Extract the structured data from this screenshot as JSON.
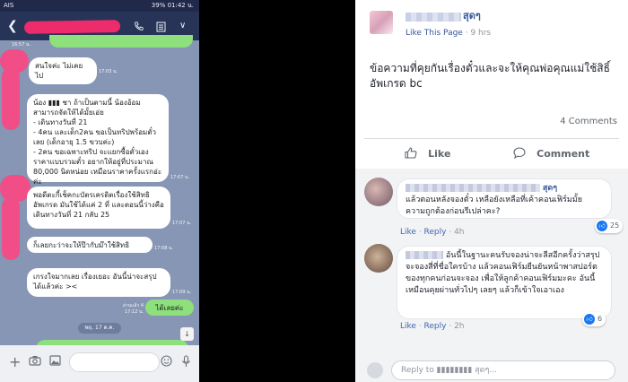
{
  "phone": {
    "status_left": "AIS",
    "status_right": "39% 01:42 น.",
    "header_icons": [
      "back-icon",
      "phone-icon",
      "notes-icon",
      "chevron-down-icon"
    ],
    "messages": [
      {
        "id": "m0",
        "text": "",
        "time": "16:57 น.",
        "side": "left"
      },
      {
        "id": "m1",
        "text": "สนใจค่ะ ไม่เคยไป",
        "time": "17:03 น.",
        "side": "left"
      },
      {
        "id": "m2",
        "text": "น้อง ▮▮▮ ชา ถ้าเป็นตามนี้ น้องอ้อม สามารถจัดให้ได้มั้ยเอ่ย\n- เดินทางวันที่ 21\n- 4คน และเด็ก2คน ขอเป็นทริปพร้อมตั๋วเลย (เด็กอายุ 1.5 ขวบค่ะ)\n- 2คน ขอเฉพาะทริป จะแยกซื้อตั๋วเอง ราคาแบบรวมตั๋ว อยากให้อยู่ที่ประมาณ 80,000 นิดหน่อย เหมือนราคาครั้งแรกอ่ะค่ะ",
        "time": "17:07 น.",
        "side": "left"
      },
      {
        "id": "m3",
        "text": "พอดีตะกี้เช็คกะบัตรเครดิตเรื่องใช้สิทธิอัพเกรด มันใช้ได้แค่ 2 ที่ และตอนนี้ว่างคือเดินทางวันที่ 21 กลับ 25",
        "time": "17:07 น.",
        "side": "left"
      },
      {
        "id": "m4",
        "text": "ก็เลยกะว่าจะให้ป๊ากับม๊าใช้สิทธิ",
        "time": "17:08 น.",
        "side": "left"
      },
      {
        "id": "m5",
        "text": "เกรงใจมากเลย เรื่องเยอะ อันนี้น่าจะสรุปได้แล้วค่ะ >< ",
        "time": "17:09 น.",
        "side": "left"
      },
      {
        "id": "m6",
        "text": "ได้เลยค่ะ",
        "time": "17:12 น.",
        "read": "อ่านแล้ว 4",
        "side": "right"
      }
    ],
    "date_divider": "พฤ. 17 ต.ค.",
    "input_bar_icons": [
      "plus-icon",
      "camera-icon",
      "image-icon",
      "emoji-icon",
      "microphone-icon"
    ]
  },
  "fb": {
    "page_name_suffix": "สุดๆ",
    "like_page": "Like This Page",
    "separator": " · ",
    "post_age": "9 hrs",
    "post_text": "ข้อความที่คุยกันเรื่องตั๋วและจะให้คุณพ่อคุณแม่ใช้สิธิ์อัพเกรด bc",
    "comment_count": "4 Comments",
    "actions": {
      "like": "Like",
      "comment": "Comment"
    },
    "comments": [
      {
        "name_suffix": "สุดๆ",
        "text": "แล้วตอนหลังจองตั๋ว เหลือยังเหลือที่เค้าคอนเฟิร์มมั้ย ความถูกต้องก่อนรีเปล่าคะ?",
        "like": "Like",
        "reply": "Reply",
        "age": "4h",
        "reactions": "25"
      },
      {
        "name_suffix": "",
        "text": "อันนี้ในฐานะคนรับจองน่าจะลีสอีกครั้งว่าสรุปจะจองสี่ที่ชื่อใครบ้าง แล้วคอนเฟิร์มยืนยันหน้าพาสปอร์ตของทุกคนก่อนจะจอง เพื่อให้ลูกค้าคอนเฟิร์มมะคะ อันนี้เหมือนคุยผ่านทั่วไปๆ เลยๆ แล้วก็เข้าใจเอาเอง",
        "like": "Like",
        "reply": "Reply",
        "age": "2h",
        "reactions": "6"
      }
    ],
    "reply_placeholder": "Reply to ▮▮▮▮▮▮▮▮ สุดๆ...",
    "colors": {
      "link": "#365899",
      "accent": "#1877f2",
      "text": "#1d2129",
      "muted": "#90949c"
    }
  }
}
